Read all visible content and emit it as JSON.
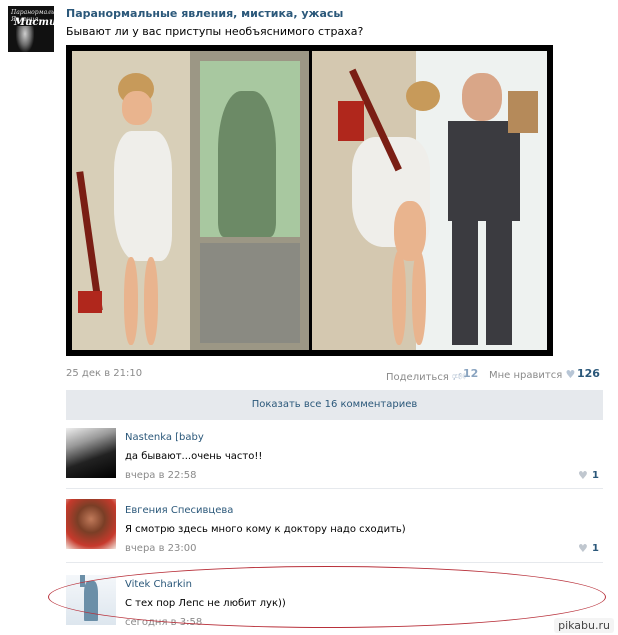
{
  "post": {
    "group_name": "Паранормальные явления, мистика, ужасы",
    "text": "Бывают ли у вас приступы необъяснимого страха?",
    "avatar_caption": "Паранормальные Явления",
    "avatar_word": "Мистика",
    "date": "25 дек в 21:10",
    "share_label": "Поделиться",
    "share_count": "12",
    "like_label": "Мне нравится",
    "like_count": "126"
  },
  "show_all_label": "Показать все 16 комментариев",
  "comments": [
    {
      "author": "Nastenka [baby",
      "text": "да бывают...очень часто!!",
      "time": "вчера в 22:58",
      "likes": "1"
    },
    {
      "author": "Евгения Спесивцева",
      "text": "Я смотрю здесь много кому к доктору надо сходить)",
      "time": "вчера в 23:00",
      "likes": "1"
    },
    {
      "author": "Vitek Charkin",
      "text": "С тех пор Лепс не любит лук))",
      "time": "сегодня в 3:58"
    }
  ],
  "watermark": "pikabu.ru",
  "colors": {
    "link": "#2b587a",
    "muted": "#8a8a8a",
    "bar": "#e6e9ed",
    "highlight": "#b8303a"
  },
  "icons": {
    "share": "megaphone-icon",
    "like": "heart-icon"
  }
}
